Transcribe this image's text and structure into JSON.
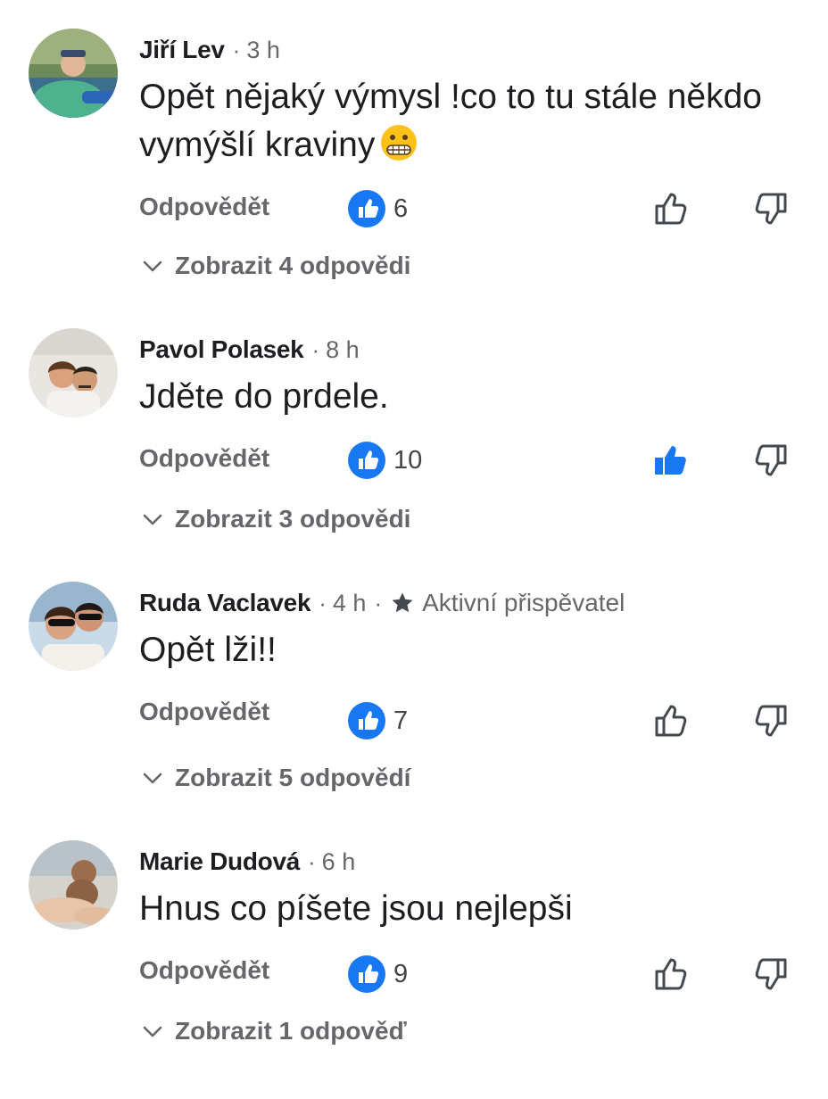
{
  "comments": [
    {
      "author": "Jiří Lev",
      "time": "3 h",
      "text": "Opět nějaký výmysl !co to tu stále někdo vymýšlí kraviny",
      "emoji": "grimacing-face",
      "reply_label": "Odpovědět",
      "like_count": "6",
      "thumbs_up_active": false,
      "replies_label": "Zobrazit 4 odpovědi"
    },
    {
      "author": "Pavol Polasek",
      "time": "8 h",
      "text": "Jděte do prdele.",
      "reply_label": "Odpovědět",
      "like_count": "10",
      "thumbs_up_active": true,
      "replies_label": "Zobrazit 3 odpovědi"
    },
    {
      "author": "Ruda Vaclavek",
      "time": "4 h",
      "badge": "Aktivní přispěvatel",
      "text": "Opět lži!!",
      "reply_label": "Odpovědět",
      "like_count": "7",
      "thumbs_up_active": false,
      "replies_label": "Zobrazit 5 odpovědí"
    },
    {
      "author": "Marie Dudová",
      "time": "6 h",
      "text": "Hnus co píšete jsou nejlepši",
      "reply_label": "Odpovědět",
      "like_count": "9",
      "thumbs_up_active": false,
      "replies_label": "Zobrazit 1 odpověď"
    }
  ],
  "separator": "·",
  "colors": {
    "like_blue": "#1877f2",
    "muted_text": "#65676b",
    "icon_gray": "#444950"
  }
}
